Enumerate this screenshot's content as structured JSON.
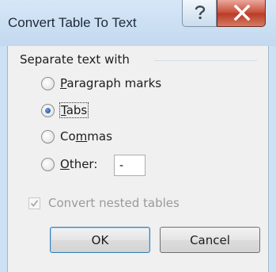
{
  "window": {
    "title": "Convert Table To Text"
  },
  "group": {
    "label": "Separate text with"
  },
  "options": [
    {
      "pre": "",
      "key": "P",
      "post": "aragraph marks",
      "selected": false
    },
    {
      "pre": "",
      "key": "T",
      "post": "abs",
      "selected": true
    },
    {
      "pre": "Co",
      "key": "m",
      "post": "mas",
      "selected": false
    },
    {
      "pre": "",
      "key": "O",
      "post": "ther:",
      "selected": false
    }
  ],
  "other_value": "-",
  "nested": {
    "label": "Convert nested tables",
    "checked": true,
    "disabled": true
  },
  "buttons": {
    "ok": "OK",
    "cancel": "Cancel"
  },
  "icons": {
    "help": "help-question-icon",
    "close": "close-x-icon",
    "check": "checkmark-icon"
  },
  "colors": {
    "titlebar": "#c3d9ef",
    "close": "#c74a35",
    "dialog_bg": "#f0f0f0"
  }
}
